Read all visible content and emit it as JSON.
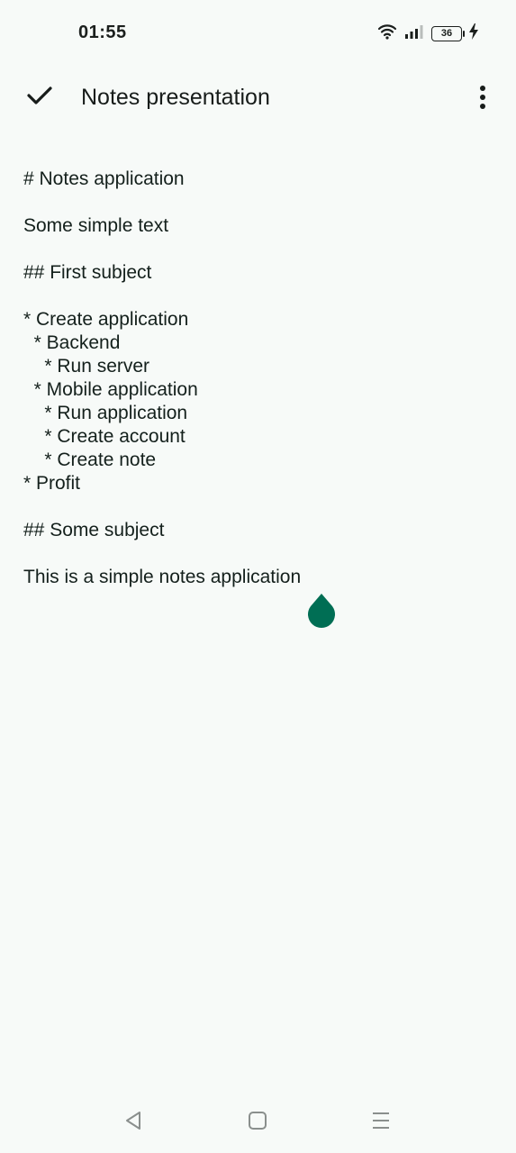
{
  "status_bar": {
    "time": "01:55",
    "battery_level": "36",
    "icons": [
      "wifi-icon",
      "signal-icon",
      "battery-icon",
      "charging-icon"
    ]
  },
  "app_bar": {
    "title": "Notes presentation",
    "confirm_icon": "check-icon",
    "menu_icon": "more-vert-icon"
  },
  "editor": {
    "lines": [
      "# Notes application",
      "",
      "Some simple text",
      "",
      "## First subject",
      "",
      "* Create application",
      "  * Backend",
      "    * Run server",
      "  * Mobile application",
      "    * Run application",
      "    * Create account",
      "    * Create note",
      "* Profit",
      "",
      "## Some subject",
      "",
      "This is a simple notes application"
    ],
    "cursor_handle_color": "#006e54"
  },
  "nav_bar": {
    "icons": [
      "back-icon",
      "home-icon",
      "recents-icon"
    ]
  }
}
